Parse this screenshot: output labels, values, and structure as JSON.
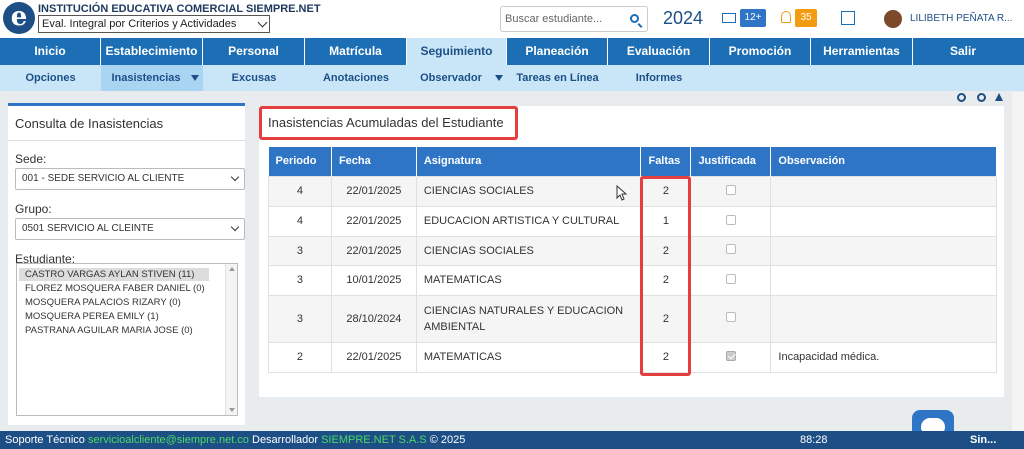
{
  "header": {
    "institution": "INSTITUCIÓN EDUCATIVA COMERCIAL SIEMPRE.NET",
    "eval_mode": "Eval. Integral por Criterios y Actividades",
    "search_placeholder": "Buscar estudiante...",
    "year": "2024",
    "messages_count": "12+",
    "notifications_count": "35",
    "user_name": "LILIBETH PEÑATA R..."
  },
  "nav": {
    "items": [
      "Inicio",
      "Establecimiento",
      "Personal",
      "Matrícula",
      "Seguimiento",
      "Planeación",
      "Evaluación",
      "Promoción",
      "Herramientas",
      "Salir"
    ],
    "active": "Seguimiento"
  },
  "subnav": {
    "items": [
      "Opciones",
      "Inasistencias",
      "Excusas",
      "Anotaciones",
      "Observador",
      "Tareas en Línea",
      "Informes"
    ],
    "active": "Inasistencias"
  },
  "left_panel": {
    "title": "Consulta de Inasistencias",
    "sede_label": "Sede:",
    "sede_value": "001 - SEDE SERVICIO AL CLIENTE",
    "grupo_label": "Grupo:",
    "grupo_value": "0501 SERVICIO AL CLEINTE",
    "estudiante_label": "Estudiante:",
    "students": [
      "CASTRO VARGAS AYLAN STIVEN (11)",
      "FLOREZ MOSQUERA FABER DANIEL (0)",
      "MOSQUERA PALACIOS RIZARY (0)",
      "MOSQUERA PEREA EMILY (1)",
      "PASTRANA AGUILAR MARIA JOSE (0)"
    ]
  },
  "right_panel": {
    "title": "Inasistencias Acumuladas  del Estudiante",
    "columns": [
      "Periodo",
      "Fecha",
      "Asignatura",
      "Faltas",
      "Justificada",
      "Observación"
    ],
    "rows": [
      {
        "periodo": "4",
        "fecha": "22/01/2025",
        "asignatura": "CIENCIAS SOCIALES",
        "faltas": "2",
        "justificada": false,
        "observacion": ""
      },
      {
        "periodo": "4",
        "fecha": "22/01/2025",
        "asignatura": "EDUCACION ARTISTICA Y CULTURAL",
        "faltas": "1",
        "justificada": false,
        "observacion": ""
      },
      {
        "periodo": "3",
        "fecha": "22/01/2025",
        "asignatura": "CIENCIAS SOCIALES",
        "faltas": "2",
        "justificada": false,
        "observacion": ""
      },
      {
        "periodo": "3",
        "fecha": "10/01/2025",
        "asignatura": "MATEMATICAS",
        "faltas": "2",
        "justificada": false,
        "observacion": ""
      },
      {
        "periodo": "3",
        "fecha": "28/10/2024",
        "asignatura": "CIENCIAS NATURALES Y EDUCACION AMBIENTAL",
        "faltas": "2",
        "justificada": false,
        "observacion": ""
      },
      {
        "periodo": "2",
        "fecha": "22/01/2025",
        "asignatura": "MATEMATICAS",
        "faltas": "2",
        "justificada": true,
        "observacion": "Incapacidad médica."
      }
    ]
  },
  "footer": {
    "support_label": "Soporte Técnico",
    "support_email": "servicioalcliente@siempre.net.co",
    "dev_label": "Desarrollador",
    "dev_name": "SIEMPRE.NET S.A.S",
    "copyright": "© 2025",
    "timer": "88:28",
    "brand": "Sin..."
  },
  "colors": {
    "nav_blue": "#1d6fb5",
    "subnav_blue": "#c8e6f8",
    "table_header": "#2e75c6",
    "highlight_red": "#e53e3e",
    "footer_blue": "#1d4f86"
  }
}
